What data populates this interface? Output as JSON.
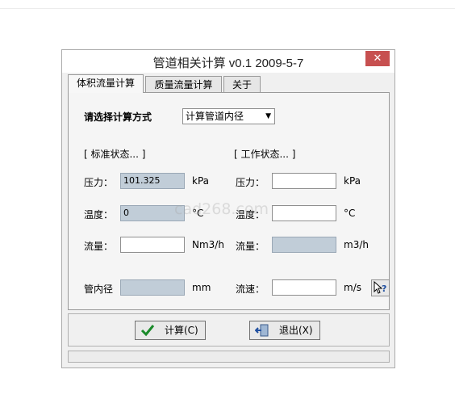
{
  "window": {
    "title": "管道相关计算 v0.1 2009-5-7",
    "close_label": "✕"
  },
  "tabs": [
    {
      "label": "体积流量计算",
      "active": true
    },
    {
      "label": "质量流量计算",
      "active": false
    },
    {
      "label": "关于",
      "active": false
    }
  ],
  "method": {
    "label": "请选择计算方式",
    "selected": "计算管道内径"
  },
  "standard": {
    "header": "[ 标准状态... ]",
    "pressure": {
      "label": "压力：",
      "value": "101.325",
      "unit": "kPa"
    },
    "temperature": {
      "label": "温度：",
      "value": "0",
      "unit": "°C"
    },
    "flow": {
      "label": "流量：",
      "value": "",
      "unit": "Nm3/h"
    },
    "diameter": {
      "label": "管内径",
      "value": "",
      "unit": "mm"
    }
  },
  "working": {
    "header": "[ 工作状态... ]",
    "pressure": {
      "label": "压力：",
      "value": "",
      "unit": "kPa"
    },
    "temperature": {
      "label": "温度：",
      "value": "",
      "unit": "°C"
    },
    "flow": {
      "label": "流量：",
      "value": "",
      "unit": "m3/h"
    },
    "velocity": {
      "label": "流速：",
      "value": "",
      "unit": "m/s"
    }
  },
  "buttons": {
    "calculate": "计算(C)",
    "exit": "退出(X)"
  },
  "watermark": "cad268.com",
  "colors": {
    "readonly_field": "#c1cdd8",
    "close_button": "#c75050"
  },
  "icons": {
    "help": "help-pointer-icon",
    "check": "check-icon",
    "exit": "exit-door-icon"
  }
}
